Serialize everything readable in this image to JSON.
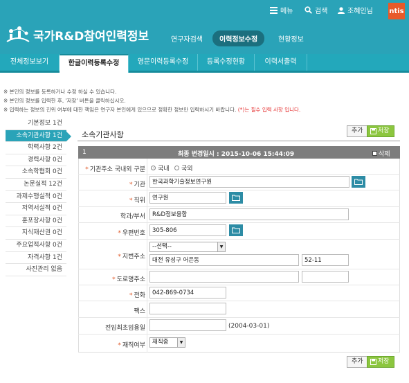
{
  "util": {
    "menu": "메뉴",
    "search": "검색",
    "user": "조혜인님",
    "logo": "ntis"
  },
  "brand": {
    "title": "국가R&D참여인력정보"
  },
  "topnav": [
    "연구자검색",
    "이력정보수정",
    "현황정보"
  ],
  "tabs": [
    "전체정보보기",
    "한글이력등록수정",
    "영문이력등록수정",
    "등록수정현황",
    "이력서출력"
  ],
  "notes": {
    "n1": "※ 본인의 정보를 등록하거나 수정 하실 수 있습니다.",
    "n2": "※ 본인의 정보를 입력한 후, '저장' 버튼을 클릭하십시오.",
    "n3": "※ 입력하는 정보의 진위 여부에 대한 책임은 연구자 본인에게 있으므로 정확한 정보만 입력하시기 바랍니다.",
    "n3_red": "(*)는 필수 입력 사항 입니다."
  },
  "sidebar": [
    "기본정보 1건",
    "소속기관사항 1건",
    "학력사항 2건",
    "경력사항 0건",
    "소속학협회 0건",
    "논문실적 12건",
    "과제수행실적 0건",
    "저역서실적 0건",
    "훈포장사항 0건",
    "지식재산권 0건",
    "주요업적사항 0건",
    "자격사항 1건",
    "사진관리 없음"
  ],
  "section": {
    "title": "소속기관사항",
    "add": "추가",
    "save": "저장",
    "row_no": "1",
    "modified": "최종 변경일시 : 2015-10-06 15:44:09",
    "delete": "삭제"
  },
  "form": {
    "region_label": "기관주소 국내외 구분",
    "region_opt1": "국내",
    "region_opt2": "국외",
    "org_label": "기관",
    "org_value": "한국과학기술정보연구원",
    "position_label": "직위",
    "position_value": "연구원",
    "dept_label": "학과/부서",
    "dept_value": "R&D정보융합",
    "zip_label": "우편번호",
    "zip_value": "305-806",
    "addr_label": "지번주소",
    "addr_select": "--선택--",
    "addr1_value": "대전 유성구 어은동",
    "addr2_value": "52-11",
    "road_label": "도로명주소",
    "phone_label": "전화",
    "phone_value": "042-869-0734",
    "fax_label": "팩스",
    "firstdate_label": "전임최초임용일",
    "firstdate_hint": "(2004-03-01)",
    "status_label": "재직여부",
    "status_value": "재직중"
  }
}
